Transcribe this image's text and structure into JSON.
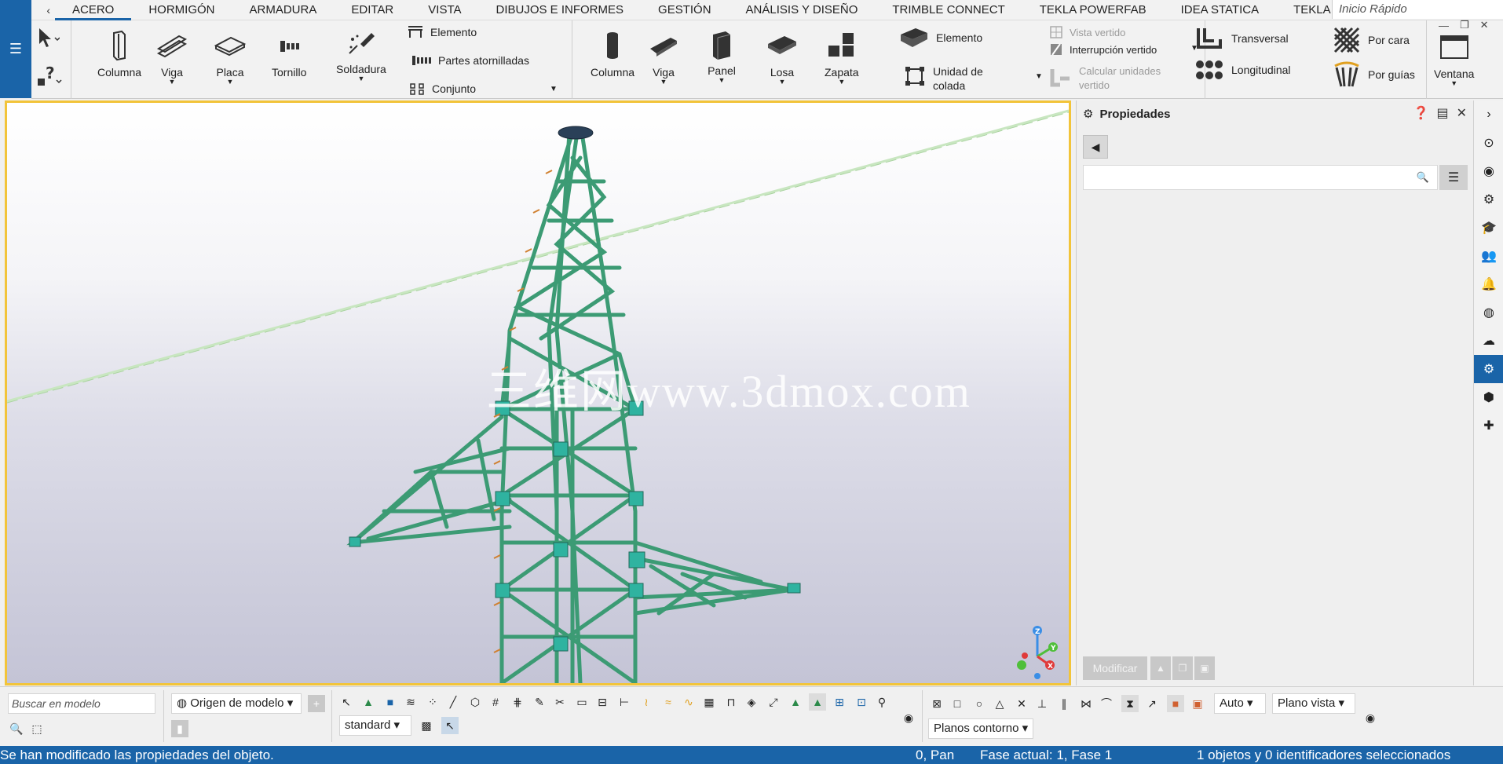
{
  "ribbon_tabs": [
    {
      "label": "ACERO"
    },
    {
      "label": "HORMIGÓN"
    },
    {
      "label": "ARMADURA"
    },
    {
      "label": "EDITAR"
    },
    {
      "label": "VISTA"
    },
    {
      "label": "DIBUJOS E INFORMES"
    },
    {
      "label": "GESTIÓN"
    },
    {
      "label": "ANÁLISIS Y DISEÑO"
    },
    {
      "label": "TRIMBLE CONNECT"
    },
    {
      "label": "TEKLA POWERFAB"
    },
    {
      "label": "IDEA STATICA"
    },
    {
      "label": "TEKLA T"
    }
  ],
  "quick_search": {
    "placeholder": "Inicio Rápido"
  },
  "steel": {
    "columna": "Columna",
    "viga": "Viga",
    "placa": "Placa",
    "tornillo": "Tornillo",
    "soldadura": "Soldadura",
    "elemento": "Elemento",
    "partes_atornilladas": "Partes atornilladas",
    "conjunto": "Conjunto"
  },
  "concrete": {
    "columna": "Columna",
    "viga": "Viga",
    "panel": "Panel",
    "losa": "Losa",
    "zapata": "Zapata",
    "elemento": "Elemento",
    "unidad_colada_1": "Unidad de",
    "unidad_colada_2": "colada",
    "vista_vertido": "Vista vertido",
    "interrupcion_vertido": "Interrupción vertido",
    "calcular_1": "Calcular unidades",
    "calcular_2": "vertido"
  },
  "rebar": {
    "transversal": "Transversal",
    "longitudinal": "Longitudinal",
    "por_cara": "Por cara",
    "por_guias": "Por guías"
  },
  "window": {
    "ventana": "Ventana"
  },
  "viewport": {
    "watermark": "三维网www.3dmox.com"
  },
  "properties": {
    "title": "Propiedades",
    "modify_button": "Modificar"
  },
  "bottom": {
    "search_placeholder": "Buscar en modelo",
    "origin": "Origen de modelo",
    "standard": "standard",
    "auto": "Auto",
    "plano_vista": "Plano vista",
    "planos_contorno": "Planos contorno"
  },
  "status": {
    "message": "Se han modificado las propiedades del objeto.",
    "pan": "0, Pan",
    "phase": "Fase actual: 1, Fase 1",
    "selection": "1 objetos y 0 identificadores seleccionados"
  },
  "colors": {
    "accent": "#1a64a8",
    "viewport_border": "#f2c43a",
    "steel": "#4aa87e"
  }
}
